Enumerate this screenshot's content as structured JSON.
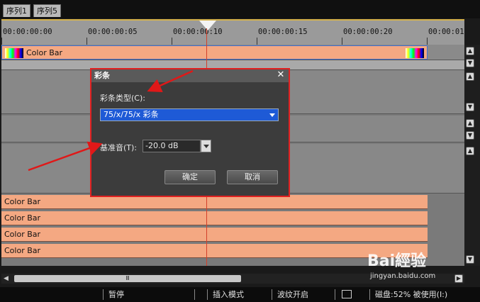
{
  "tabs": [
    "序列1",
    "序列5"
  ],
  "ruler": {
    "timecodes": [
      "00:00:00:00",
      "00:00:00:05",
      "00:00:00:10",
      "00:00:00:15",
      "00:00:00:20",
      "00:00:01"
    ]
  },
  "tracks": {
    "top_clip_label": "Color Bar",
    "lower_clips": [
      "Color Bar",
      "Color Bar",
      "Color Bar",
      "Color Bar"
    ]
  },
  "dialog": {
    "title": "彩条",
    "type_label": "彩条类型(C):",
    "type_value": "75/x/75/x 彩条",
    "volume_label": "基准音(T):",
    "volume_value": "-20.0 dB",
    "ok_label": "确定",
    "cancel_label": "取消",
    "close_glyph": "✕"
  },
  "hscroll": {
    "thumb_glyph": "Ⅲ"
  },
  "status": {
    "pause": "暂停",
    "insert_mode": "插入模式",
    "ripple": "波纹开启",
    "disk": "磁盘:52% 被使用(I:)"
  },
  "watermark": {
    "brand": "Bai經验",
    "url": "jingyan.baidu.com"
  },
  "colors": {
    "clip": "#f4a882",
    "playhead": "#d2402a",
    "dialog_border": "#e02020",
    "dropdown": "#1e5ad6"
  }
}
